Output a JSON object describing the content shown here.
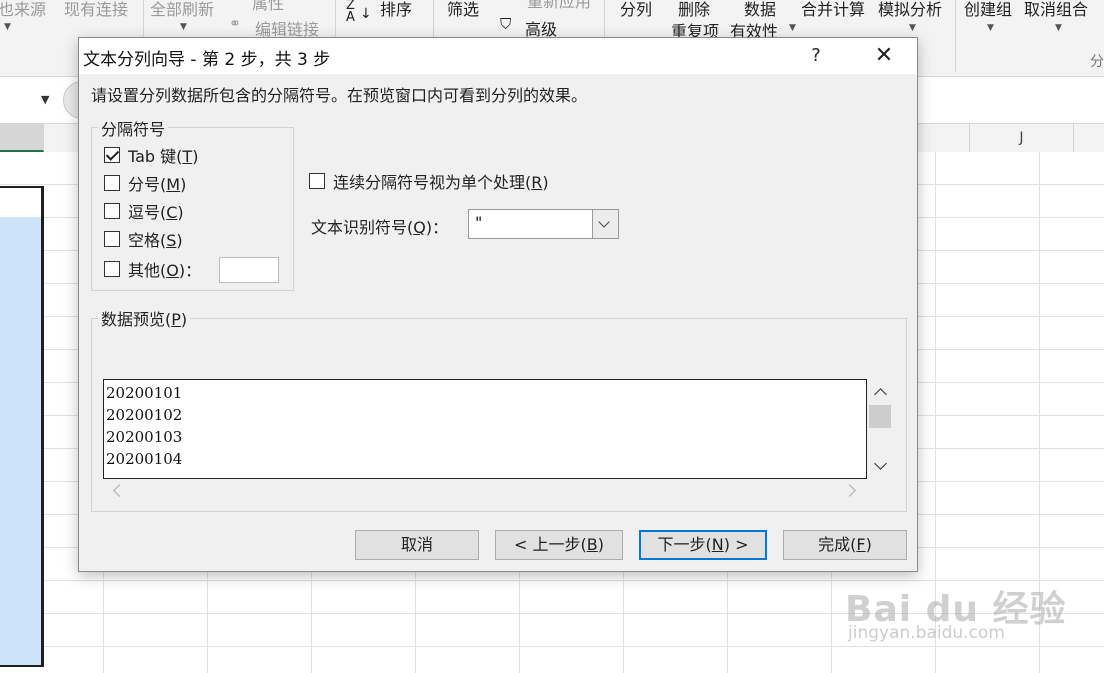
{
  "ribbon": {
    "items": [
      {
        "id": "data-source",
        "label": "也来源",
        "dim": true
      },
      {
        "id": "existing-connections",
        "label": "现有连接",
        "dim": true
      },
      {
        "id": "refresh-all",
        "label": "全部刷新",
        "dim": true
      },
      {
        "id": "properties",
        "label": "属性",
        "dim": true
      },
      {
        "id": "edit-links",
        "label": "编辑链接",
        "dim": true
      },
      {
        "id": "sort",
        "label": "排序",
        "dim": false
      },
      {
        "id": "filter",
        "label": "筛选",
        "dim": false
      },
      {
        "id": "reapply",
        "label": "重新应用",
        "dim": true
      },
      {
        "id": "advanced",
        "label": "高级",
        "dim": false
      },
      {
        "id": "text-to-columns",
        "label": "分列",
        "dim": false
      },
      {
        "id": "remove-duplicates",
        "label": "删除",
        "dim": false
      },
      {
        "id": "data-validation",
        "label": "数据",
        "dim": false
      },
      {
        "id": "consolidate",
        "label": "合并计算",
        "dim": false
      },
      {
        "id": "what-if",
        "label": "模拟分析",
        "dim": false
      },
      {
        "id": "group",
        "label": "创建组",
        "dim": false
      },
      {
        "id": "ungroup",
        "label": "取消组合",
        "dim": false
      },
      {
        "id": "remove-dup-2",
        "label": "重复项",
        "dim": false
      },
      {
        "id": "validity",
        "label": "有效性",
        "dim": false
      },
      {
        "id": "outline-label",
        "label": "分",
        "dim": true
      }
    ]
  },
  "sheet": {
    "columns": [
      "J"
    ]
  },
  "dialog": {
    "title": "文本分列向导 - 第 2 步，共 3 步",
    "help": "?",
    "close": "✕",
    "instruction": "请设置分列数据所包含的分隔符号。在预览窗口内可看到分列的效果。",
    "delimiters": {
      "group_label": "分隔符号",
      "tab": {
        "label": "Tab 键(",
        "key": "T",
        "suffix": ")",
        "checked": true
      },
      "semicolon": {
        "label": "分号(",
        "key": "M",
        "suffix": ")",
        "checked": false
      },
      "comma": {
        "label": "逗号(",
        "key": "C",
        "suffix": ")",
        "checked": false
      },
      "space": {
        "label": "空格(",
        "key": "S",
        "suffix": ")",
        "checked": false
      },
      "other": {
        "label": "其他(",
        "key": "O",
        "suffix": ")：",
        "checked": false,
        "value": ""
      }
    },
    "consecutive": {
      "label": "连续分隔符号视为单个处理(",
      "key": "R",
      "suffix": ")",
      "checked": false
    },
    "qualifier": {
      "label": "文本识别符号(",
      "key": "Q",
      "suffix": ")：",
      "value": "\""
    },
    "preview": {
      "group_label": "数据预览(",
      "key": "P",
      "suffix": ")",
      "lines": [
        "20200101",
        "20200102",
        "20200103",
        "20200104"
      ]
    },
    "buttons": {
      "cancel": "取消",
      "back": {
        "label": "< 上一步(",
        "key": "B",
        "suffix": ")"
      },
      "next": {
        "label": "下一步(",
        "key": "N",
        "suffix": ") >"
      },
      "finish": {
        "label": "完成(",
        "key": "F",
        "suffix": ")"
      }
    }
  },
  "watermark": {
    "brand": "Bai du 经验",
    "url": "jingyan.baidu.com"
  }
}
